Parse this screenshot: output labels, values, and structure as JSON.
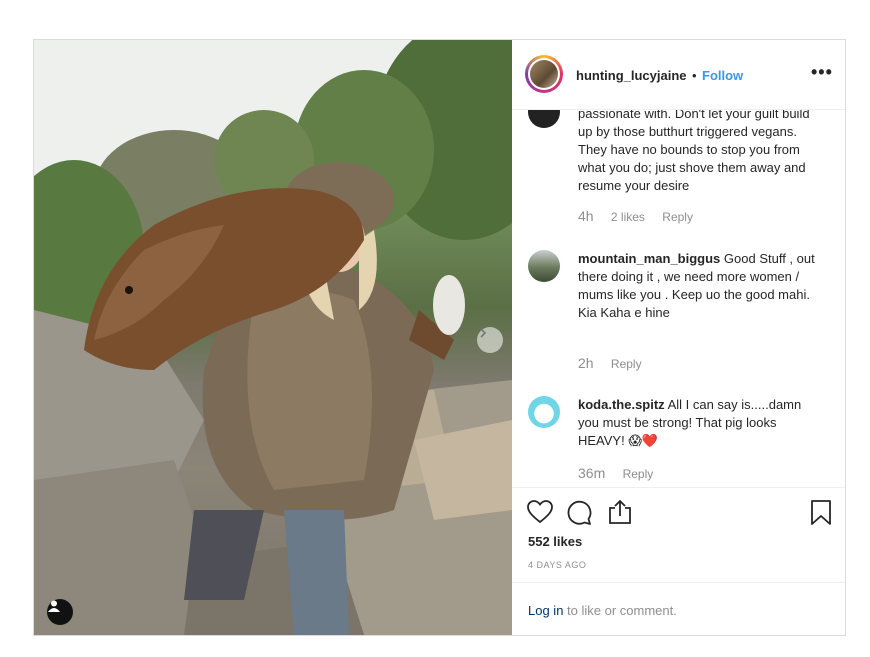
{
  "header": {
    "username": "hunting_lucyjaine",
    "separator": "•",
    "follow_label": "Follow",
    "more_label": "•••"
  },
  "comments": [
    {
      "user": "",
      "text": "passionate with. Don't let your guilt build up by those butthurt triggered vegans. They have no bounds to stop you from what you do; just shove them away and resume your desire",
      "time": "4h",
      "likes": "2 likes",
      "reply": "Reply"
    },
    {
      "user": "mountain_man_biggus",
      "text": " Good Stuff , out there doing it , we need more women / mums like you . Keep uo the good mahi.",
      "text2": "Kia Kaha e hine",
      "time": "2h",
      "reply": "Reply"
    },
    {
      "user": "koda.the.spitz",
      "text": " All I can say is.....damn you must be strong! That pig looks HEAVY! 😱❤️",
      "time": "36m",
      "reply": "Reply"
    }
  ],
  "actions": {
    "likes": "552 likes",
    "date": "4 DAYS AGO",
    "icons": [
      "heart-icon",
      "comment-icon",
      "share-icon",
      "bookmark-icon"
    ]
  },
  "footer": {
    "login_link": "Log in",
    "login_rest": " to like or comment."
  },
  "colors": {
    "link_blue": "#3897f0",
    "login_blue": "#003569",
    "muted": "#8e8e8e",
    "text": "#262626"
  }
}
